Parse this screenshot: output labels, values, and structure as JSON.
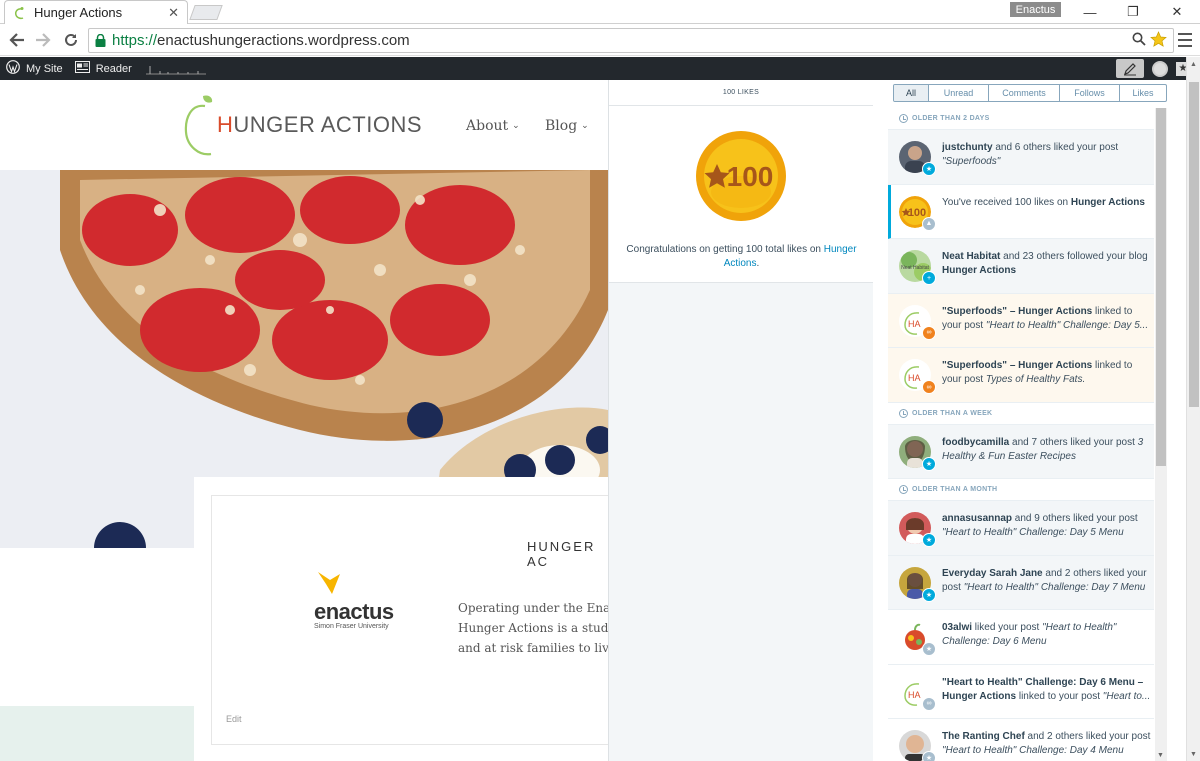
{
  "browser": {
    "tab_title": "Hunger Actions",
    "tab_close": "✕",
    "user": "Enactus",
    "url_scheme": "https://",
    "url_rest": "enactushungeractions.wordpress.com",
    "minimize": "—",
    "restore": "❐",
    "close": "✕"
  },
  "adminbar": {
    "my_site": "My Site",
    "reader": "Reader"
  },
  "site": {
    "logo_text_h": "H",
    "logo_text_rest": "UNGER ACTIONS",
    "nav": [
      {
        "label": "About"
      },
      {
        "label": "Blog"
      }
    ],
    "content_heading": "HUNGER AC",
    "enactus_word": "enactus",
    "enactus_sub": "Simon Fraser University",
    "about_lines": [
      "Operating under the Enactus",
      "Hunger Actions is a student",
      "and at risk families to live a"
    ],
    "edit": "Edit"
  },
  "detail": {
    "header": "100 LIKES",
    "badge_number": "100",
    "congrats_prefix": "Congratulations on getting 100 total likes on",
    "congrats_link": "Hunger Actions",
    "congrats_suffix": "."
  },
  "filters": [
    {
      "label": "All",
      "active": true
    },
    {
      "label": "Unread"
    },
    {
      "label": "Comments"
    },
    {
      "label": "Follows"
    },
    {
      "label": "Likes"
    }
  ],
  "sections": {
    "s1": "OLDER THAN 2 DAYS",
    "s2": "OLDER THAN A WEEK",
    "s3": "OLDER THAN A MONTH"
  },
  "notes": [
    {
      "actor": "justchunty",
      "text": " and 6 others liked your post ",
      "italic": "\"Superfoods\"",
      "state": "read",
      "badge_color": "#00aadc",
      "badge_icon": "★"
    },
    {
      "actor": "",
      "text": "You've received 100 likes on ",
      "bold2": "Hunger Actions",
      "state": "selected",
      "badge_color": "#a8bece",
      "badge_icon": "👍"
    },
    {
      "actor": "Neat Habitat",
      "text": " and 23 others followed your blog ",
      "bold2": "Hunger Actions",
      "state": "read",
      "badge_color": "#00aadc",
      "badge_icon": "+"
    },
    {
      "actor": "\"Superfoods\" – Hunger Actions",
      "text": " linked to your post ",
      "italic": "\"Heart to Health\" Challenge: Day 5...",
      "state": "unread",
      "badge_color": "#f0821e",
      "badge_icon": "∞"
    },
    {
      "actor": "\"Superfoods\" – Hunger Actions",
      "text": " linked to your post ",
      "italic": "Types of Healthy Fats.",
      "state": "unread",
      "badge_color": "#f0821e",
      "badge_icon": "∞"
    },
    {
      "actor": "foodbycamilla",
      "text": " and 7 others liked your post ",
      "italic": "3 Healthy & Fun Easter Recipes",
      "state": "read",
      "badge_color": "#00aadc",
      "badge_icon": "★"
    },
    {
      "actor": "annasusannap",
      "text": " and 9 others liked your post ",
      "italic": "\"Heart to Health\" Challenge: Day 5 Menu",
      "state": "read",
      "badge_color": "#00aadc",
      "badge_icon": "★"
    },
    {
      "actor": "Everyday Sarah Jane",
      "text": " and 2 others liked your post ",
      "italic": "\"Heart to Health\" Challenge: Day 7 Menu",
      "state": "read",
      "badge_color": "#00aadc",
      "badge_icon": "★"
    },
    {
      "actor": "03alwi",
      "text": " liked your post ",
      "italic": "\"Heart to Health\" Challenge: Day 6 Menu",
      "state": "white",
      "badge_color": "#a8bece",
      "badge_icon": "★"
    },
    {
      "actor": "\"Heart to Health\" Challenge: Day 6 Menu – Hunger Actions",
      "text": " linked to your post ",
      "italic": "\"Heart to...",
      "state": "white",
      "badge_color": "#a8bece",
      "badge_icon": "∞"
    },
    {
      "actor": "The Ranting Chef",
      "text": " and 2 others liked your post ",
      "italic": "\"Heart to Health\" Challenge: Day 4 Menu",
      "state": "white",
      "badge_color": "#a8bece",
      "badge_icon": "★"
    }
  ]
}
